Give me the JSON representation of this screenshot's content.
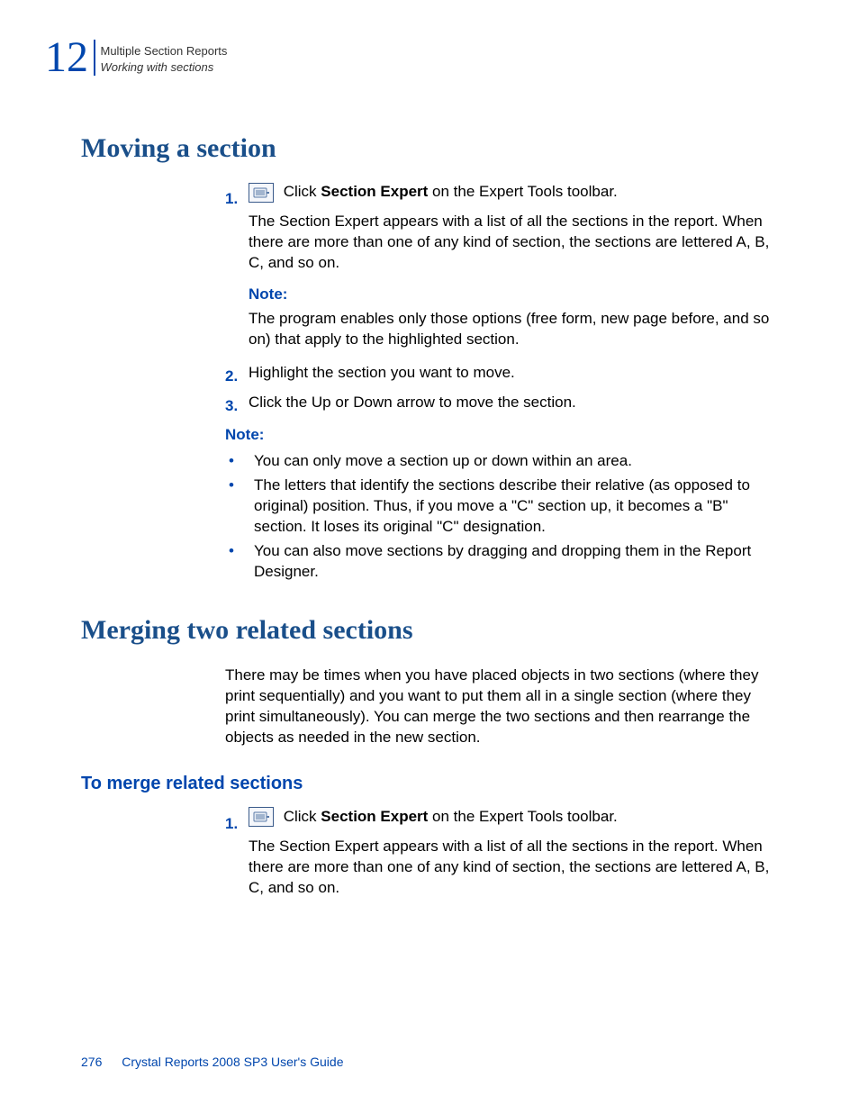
{
  "header": {
    "chapter_number": "12",
    "line1": "Multiple Section Reports",
    "line2": "Working with sections"
  },
  "heading_moving": "Moving a section",
  "moving": {
    "step1_num": "1.",
    "step1_text_prefix": " Click ",
    "step1_text_bold": "Section Expert",
    "step1_text_suffix": " on the Expert Tools toolbar.",
    "step1_body": "The Section Expert appears with a list of all the sections in the report. When there are more than one of any kind of section, the sections are lettered A, B, C, and so on.",
    "note1_label": "Note:",
    "note1_body": "The program enables only those options (free form, new page before, and so on) that apply to the highlighted section.",
    "step2_num": "2.",
    "step2_text": "Highlight the section you want to move.",
    "step3_num": "3.",
    "step3_text": "Click the Up or Down arrow to move the section.",
    "note2_label": "Note:",
    "bullets": [
      "You can only move a section up or down within an area.",
      "The letters that identify the sections describe their relative (as opposed to original) position. Thus, if you move a \"C\" section up, it becomes a \"B\" section. It loses its original \"C\" designation.",
      "You can also move sections by dragging and dropping them in the Report Designer."
    ]
  },
  "heading_merging": "Merging two related sections",
  "merging_intro": "There may be times when you have placed objects in two sections (where they print sequentially) and you want to put them all in a single section (where they print simultaneously). You can merge the two sections and then rearrange the objects as needed in the new section.",
  "sub_heading_merge": "To merge related sections",
  "merging": {
    "step1_num": "1.",
    "step1_text_prefix": " Click ",
    "step1_text_bold": "Section Expert",
    "step1_text_suffix": " on the Expert Tools toolbar.",
    "step1_body": "The Section Expert appears with a list of all the sections in the report. When there are more than one of any kind of section, the sections are lettered A, B, C, and so on."
  },
  "footer": {
    "page_num": "276",
    "doc_title": "Crystal Reports 2008 SP3 User's Guide"
  }
}
